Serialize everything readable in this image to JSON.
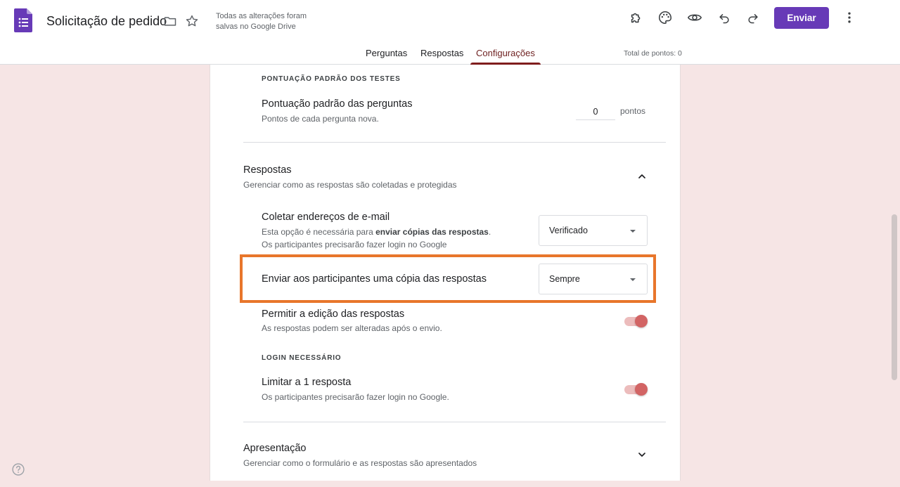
{
  "header": {
    "doc_title": "Solicitação de pedido",
    "save_status": "Todas as alterações foram salvas no Google Drive",
    "send_label": "Enviar",
    "icons": [
      "forms-logo-icon",
      "folder-icon",
      "star-icon",
      "addon-icon",
      "palette-icon",
      "preview-eye-icon",
      "undo-icon",
      "redo-icon",
      "more-vert-icon"
    ],
    "accent_color": "#673ab7"
  },
  "tabs": {
    "items": [
      {
        "label": "Perguntas"
      },
      {
        "label": "Respostas"
      },
      {
        "label": "Configurações",
        "active": true
      }
    ],
    "total_points": "Total de pontos: 0"
  },
  "quiz_defaults": {
    "section_label": "PONTUAÇÃO PADRÃO DOS TESTES",
    "default_points_title": "Pontuação padrão das perguntas",
    "default_points_desc": "Pontos de cada pergunta nova.",
    "default_points_value": "0",
    "points_unit": "pontos"
  },
  "responses": {
    "title": "Respostas",
    "description": "Gerenciar como as respostas são coletadas e protegidas",
    "collect_email": {
      "title": "Coletar endereços de e-mail",
      "desc_prefix": "Esta opção é necessária para ",
      "desc_bold": "enviar cópias das respostas",
      "desc_suffix": ".",
      "desc_line2": "Os participantes precisarão fazer login no Google",
      "value": "Verificado"
    },
    "send_copy": {
      "title": "Enviar aos participantes uma cópia das respostas",
      "value": "Sempre",
      "highlight_color": "#e8762b"
    },
    "allow_edit": {
      "title": "Permitir a edição das respostas",
      "desc": "As respostas podem ser alteradas após o envio.",
      "enabled": true
    },
    "login_label": "LOGIN NECESSÁRIO",
    "limit_one": {
      "title": "Limitar a 1 resposta",
      "desc": "Os participantes precisarão fazer login no Google.",
      "enabled": true
    }
  },
  "presentation": {
    "title": "Apresentação",
    "description": "Gerenciar como o formulário e as respostas são apresentados"
  },
  "help_icon": "help-icon"
}
